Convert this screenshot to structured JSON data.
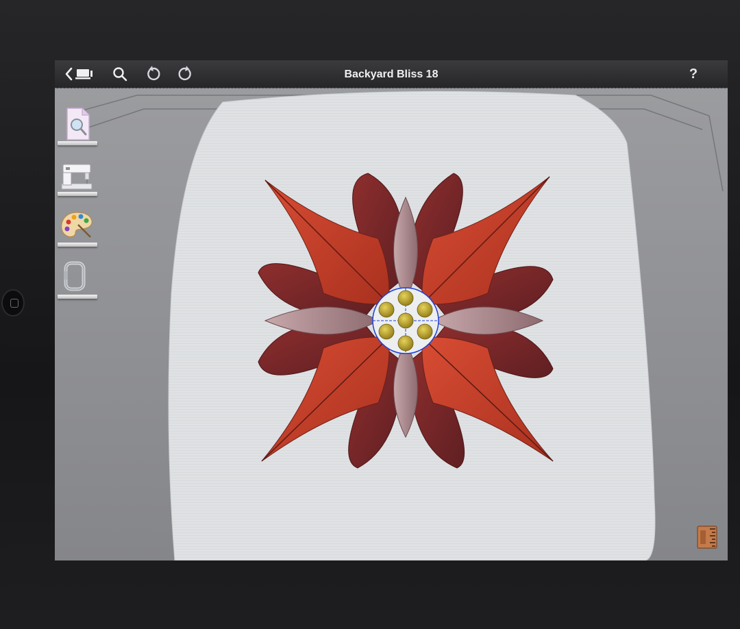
{
  "app": {
    "title": "Backyard Bliss 18"
  },
  "toolbar": {
    "back_icon": "chevron-left-icon",
    "gallery_icon": "gallery-icon",
    "zoom_icon": "search-icon",
    "undo_icon": "undo-icon",
    "redo_icon": "redo-icon",
    "help_label": "?"
  },
  "side_tools": [
    {
      "name": "design-preview-tool",
      "icon": "document-magnifier-icon"
    },
    {
      "name": "sewing-machine-tool",
      "icon": "sewing-machine-icon"
    },
    {
      "name": "color-palette-tool",
      "icon": "paint-palette-icon"
    },
    {
      "name": "hoop-tool",
      "icon": "hoop-icon"
    }
  ],
  "corner_tool": {
    "icon": "ruler-icon"
  },
  "colors": {
    "toolbar": "#2e2e31",
    "fabric": "#dfe1e3",
    "petal_bright": "#c4412b",
    "petal_dark": "#7f2a2a",
    "petal_light": "#a88a8e",
    "bead": "#b9a22e",
    "selection": "#1f3fd6"
  }
}
